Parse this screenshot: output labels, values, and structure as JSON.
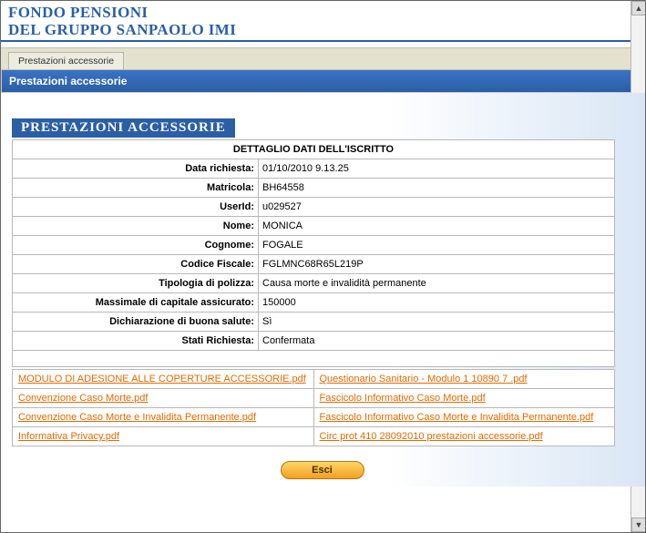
{
  "header": {
    "line1": "FONDO PENSIONI",
    "line2": "DEL GRUPPO SANPAOLO IMI"
  },
  "tabbar": {
    "tab_label": "Prestazioni accessorie"
  },
  "bluebar": {
    "title": "Prestazioni accessorie"
  },
  "section_title": "PRESTAZIONI ACCESSORIE",
  "detail_header": "DETTAGLIO DATI DELL'ISCRITTO",
  "fields": {
    "data_richiesta": {
      "label": "Data richiesta:",
      "value": "01/10/2010 9.13.25"
    },
    "matricola": {
      "label": "Matricola:",
      "value": "BH64558"
    },
    "userid": {
      "label": "UserId:",
      "value": "u029527"
    },
    "nome": {
      "label": "Nome:",
      "value": "MONICA"
    },
    "cognome": {
      "label": "Cognome:",
      "value": "FOGALE"
    },
    "codice_fiscale": {
      "label": "Codice Fiscale:",
      "value": "FGLMNC68R65L219P"
    },
    "tipologia": {
      "label": "Tipologia di polizza:",
      "value": "Causa morte e invalidità permanente"
    },
    "massimale": {
      "label": "Massimale di capitale assicurato:",
      "value": "150000"
    },
    "dichiarazione": {
      "label": "Dichiarazione di buona salute:",
      "value": "Sì"
    },
    "stato": {
      "label": "Stati Richiesta:",
      "value": "Confermata"
    }
  },
  "links": [
    {
      "left": "MODULO DI ADESIONE ALLE COPERTURE ACCESSORIE.pdf",
      "right": "Questionario Sanitario - Modulo 1 10890 7 .pdf"
    },
    {
      "left": "Convenzione Caso Morte.pdf",
      "right": "Fascicolo Informativo Caso Morte.pdf"
    },
    {
      "left": "Convenzione Caso Morte e Invalidita Permanente.pdf",
      "right": "Fascicolo Informativo Caso Morte e Invalidita Permanente.pdf"
    },
    {
      "left": "Informativa Privacy.pdf",
      "right": "Circ prot 410 28092010 prestazioni accessorie.pdf"
    }
  ],
  "buttons": {
    "esci": "Esci"
  },
  "scroll": {
    "up": "▲",
    "down": "▼"
  }
}
